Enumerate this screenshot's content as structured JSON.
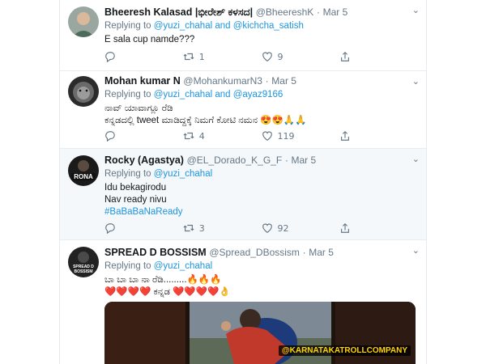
{
  "tweets": [
    {
      "name": "Bheeresh Kalasad |ಭೀರೇಶ್ ಕಳಸದ|",
      "handle": "@BheereshK",
      "date": "Mar 5",
      "replying_label": "Replying to",
      "replying_to": "@yuzi_chahal and @kichcha_satish",
      "lines": [
        "E sala cup namde???"
      ],
      "retweets": "1",
      "likes": "9"
    },
    {
      "name": "Mohan kumar N",
      "handle": "@MohankumarN3",
      "date": "Mar 5",
      "replying_label": "Replying to",
      "replying_to": "@yuzi_chahal and @ayaz9166",
      "lines": [
        "ನಾವ್ ಯಾವಾಗ್ಲೂ ರೆಡಿ",
        "ಕನ್ನಡದಲ್ಲಿ tweet ಮಾಡಿದ್ದಕ್ಕೆ ನಿಮಗೆ ಕೋಟಿ ನಮನ 😍😍🙏🙏"
      ],
      "retweets": "4",
      "likes": "119"
    },
    {
      "name": "Rocky (Agastya)",
      "handle": "@EL_Dorado_K_G_F",
      "date": "Mar 5",
      "replying_label": "Replying to",
      "replying_to": "@yuzi_chahal",
      "lines": [
        "Idu bekagirodu",
        "Nav ready nivu"
      ],
      "hashtag": "#BaBaBaNaReady",
      "avatar_text": "RONA",
      "retweets": "3",
      "likes": "92"
    },
    {
      "name": "SPREAD D BOSSISM",
      "handle": "@Spread_DBossism",
      "date": "Mar 5",
      "replying_label": "Replying to",
      "replying_to": "@yuzi_chahal",
      "lines": [
        "ಬಾ ಬಾ ಬಾ ನಾ ರೆಡಿ.........🔥🔥🔥",
        "❤️❤️❤️❤️ ಕನ್ನಡ ❤️❤️❤️❤️👌"
      ],
      "avatar_text": "SPREAD D BOSSISM"
    }
  ],
  "media": {
    "watermark": "@KARNATAKATROLLCOMPANY"
  },
  "icons": {
    "reply": "reply-icon",
    "retweet": "retweet-icon",
    "like": "heart-icon",
    "share": "share-icon",
    "caret": "chevron-down-icon"
  },
  "colors": {
    "link": "#1b95e0",
    "muted": "#657786",
    "text": "#14171a",
    "highlight_bg": "#f5f8fa"
  }
}
